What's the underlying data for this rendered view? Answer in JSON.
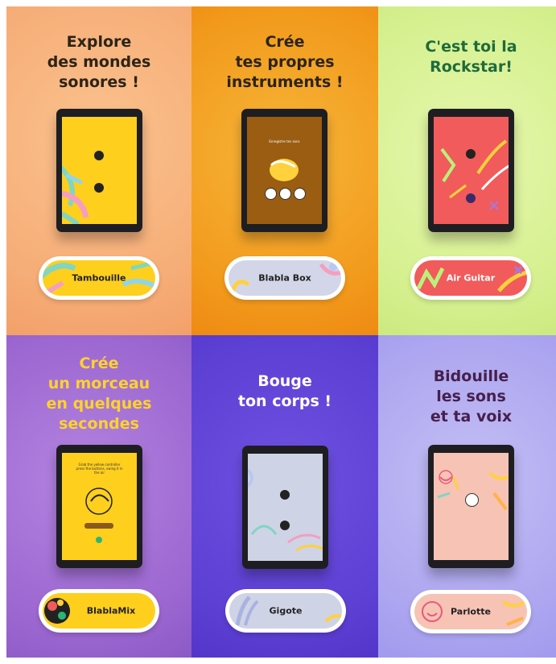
{
  "panels": [
    {
      "title": "Explore\ndes mondes\nsonores !",
      "app": "Tambouille"
    },
    {
      "title": "Crée\ntes propres\ninstruments !",
      "app": "Blabla Box",
      "screen_text": "Enregistre tes sons"
    },
    {
      "title": "C'est toi la\nRockstar!",
      "app": "Air Guitar"
    },
    {
      "title": "Crée\nun morceau\nen quelques\nsecondes",
      "app": "BlablaMix",
      "screen_text": "Grab the yellow controller press the buttons, swing it in the air"
    },
    {
      "title": "Bouge\nton corps !",
      "app": "Gigote"
    },
    {
      "title": "Bidouille\nles sons\net ta voix",
      "app": "Parlotte"
    }
  ]
}
